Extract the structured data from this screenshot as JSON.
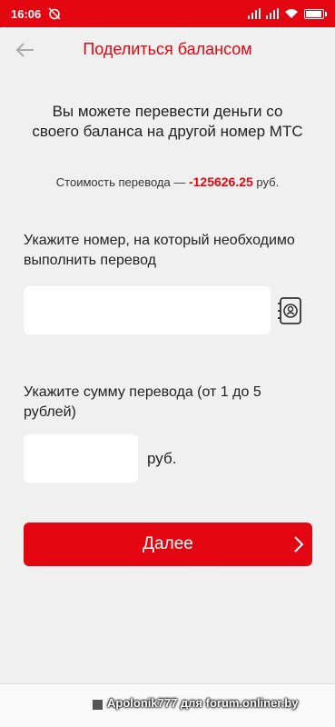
{
  "status_bar": {
    "time": "16:06"
  },
  "header": {
    "title": "Поделиться балансом"
  },
  "intro": {
    "text": "Вы можете перевести деньги со своего баланса на другой номер МТС"
  },
  "cost": {
    "prefix": "Стоимость перевода — ",
    "amount": "-125626.25",
    "suffix": " руб."
  },
  "phone": {
    "label": "Укажите номер, на который необходимо выполнить перевод",
    "value": "",
    "placeholder": ""
  },
  "amount": {
    "label": "Укажите сумму перевода (от 1 до 5 рублей)",
    "value": "",
    "placeholder": "",
    "currency": "руб."
  },
  "next_button": {
    "label": "Далее"
  },
  "watermark": {
    "text": "Apolonik777 для forum.onliner.by"
  },
  "colors": {
    "accent": "#e30611",
    "background": "#f0f0f1"
  },
  "icons": [
    "back-arrow-icon",
    "alarm-off-icon",
    "signal-icon",
    "wifi-icon",
    "battery-icon",
    "contacts-icon",
    "chevron-right-icon"
  ]
}
